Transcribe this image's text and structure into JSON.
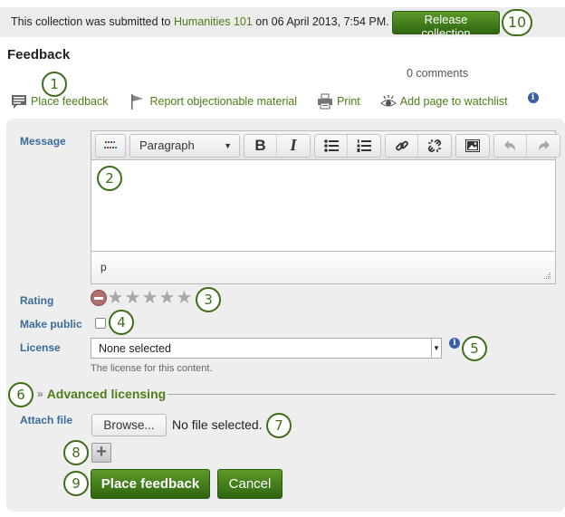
{
  "banner": {
    "text_before": "This collection was submitted to ",
    "group_link": "Humanities 101",
    "text_after": " on 06 April 2013, 7:54 PM.",
    "release_button": "Release collection"
  },
  "feedback": {
    "heading": "Feedback",
    "comment_count": "0 comments",
    "actions": [
      {
        "label": "Place feedback",
        "icon": "comment-icon"
      },
      {
        "label": "Report objectionable material",
        "icon": "flag-icon"
      },
      {
        "label": "Print",
        "icon": "printer-icon"
      },
      {
        "label": "Add page to watchlist",
        "icon": "eye-icon"
      }
    ],
    "info_glyph": "i"
  },
  "form": {
    "message_label": "Message",
    "editor": {
      "format_select": "Paragraph",
      "buttons": [
        "toggle-toolbar",
        "bold",
        "italic",
        "bullet-list",
        "numbered-list",
        "link",
        "unlink",
        "image",
        "undo",
        "redo"
      ],
      "bold_glyph": "B",
      "italic_glyph": "I",
      "status_path": "p"
    },
    "rating_label": "Rating",
    "rating_value": 0,
    "rating_max": 5,
    "make_public_label": "Make public",
    "make_public_checked": false,
    "license_label": "License",
    "license_value": "None selected",
    "license_help": "The license for this content.",
    "advanced_licensing": "Advanced licensing",
    "attach_label": "Attach file",
    "browse_button": "Browse...",
    "no_file": "No file selected.",
    "add_glyph": "+",
    "submit_button": "Place feedback",
    "cancel_button": "Cancel"
  },
  "callouts": [
    "1",
    "2",
    "3",
    "4",
    "5",
    "6",
    "7",
    "8",
    "9",
    "10"
  ],
  "colors": {
    "accent_green": "#4d7d16",
    "button_green": "#3f7a1c",
    "label_blue": "#3a6b9a",
    "panel_bg": "#eeeeee"
  }
}
